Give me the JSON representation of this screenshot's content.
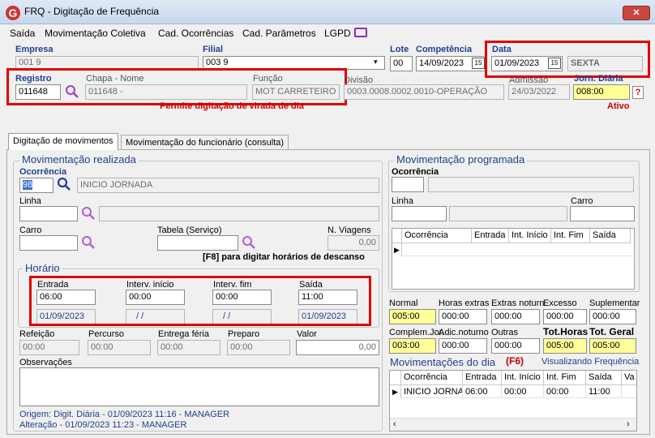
{
  "window": {
    "title": "FRQ - Digitação de Frequência",
    "close": "✕"
  },
  "menu": [
    "Saída",
    "Movimentação Coletiva",
    "Cad. Ocorrências",
    "Cad. Parâmetros",
    "LGPD"
  ],
  "header": {
    "empresa_label": "Empresa",
    "empresa_value": "001 9",
    "filial_label": "Filial",
    "filial_value": "003 9",
    "lote_label": "Lote",
    "lote_value": "00",
    "competencia_label": "Competência",
    "competencia_value": "14/09/2023",
    "data_label": "Data",
    "data_value": "01/09/2023",
    "dia_semana": "SEXTA",
    "registro_label": "Registro",
    "registro_value": "011648",
    "chapa_label": "Chapa  -  Nome",
    "chapa_value": "011648 -",
    "funcao_label": "Função",
    "funcao_value": "MOT CARRETEIRO",
    "divisao_label": "Divisão",
    "divisao_value": "0003.0008.0002.0010-OPERAÇÃO",
    "admissao_label": "Admissão",
    "admissao_value": "24/03/2022",
    "jornada_label": "Jorn. Diária",
    "jornada_value": "008:00",
    "help": "?",
    "aviso": "Permite digitação de virada de dia",
    "status": "Ativo",
    "cal_icon": "15"
  },
  "tabs": [
    "Digitação de movimentos",
    "Movimentação do funcionário (consulta)"
  ],
  "realizada": {
    "legend": "Movimentação realizada",
    "ocorrencia_label": "Ocorrência",
    "ocorrencia_code": "98",
    "ocorrencia_desc": "INICIO JORNADA",
    "linha_label": "Linha",
    "linha_value": "",
    "linha_desc": "",
    "carro_label": "Carro",
    "carro_value": "",
    "tabela_label": "Tabela (Serviço)",
    "tabela_value": "",
    "viagens_label": "N. Viagens",
    "viagens_value": "0,00",
    "hint": "[F8] para digitar horários de descanso"
  },
  "horario": {
    "legend": "Horário",
    "entrada_label": "Entrada",
    "entrada_value": "06:00",
    "entrada_data": "01/09/2023",
    "interv_ini_label": "Interv. início",
    "interv_ini_value": "00:00",
    "interv_ini_data": "/ /",
    "interv_fim_label": "Interv. fim",
    "interv_fim_value": "00:00",
    "interv_fim_data": "/ /",
    "saida_label": "Saída",
    "saida_value": "11:00",
    "saida_data": "01/09/2023"
  },
  "extras": {
    "refeicao_label": "Refeição",
    "refeicao_value": "00:00",
    "percurso_label": "Percurso",
    "percurso_value": "00:00",
    "entrega_label": "Entrega féria",
    "entrega_value": "00:00",
    "preparo_label": "Preparo",
    "preparo_value": "00:00",
    "valor_label": "Valor",
    "valor_value": "0,00",
    "obs_label": "Observações",
    "origem": "Origem: Digit. Diária - 01/09/2023 11:16 - MANAGER",
    "alteracao": "Alteração - 01/09/2023 11:23 - MANAGER"
  },
  "programada": {
    "legend": "Movimentação programada",
    "ocorrencia_label": "Ocorrência",
    "linha_label": "Linha",
    "carro_label": "Carro",
    "columns": [
      "Ocorrência",
      "Entrada",
      "Int. Início",
      "Int. Fim",
      "Saída"
    ]
  },
  "totais": {
    "normal_label": "Normal",
    "normal_value": "005:00",
    "horas_extras_label": "Horas extras",
    "horas_extras_value": "000:00",
    "extras_noturn_label": "Extras noturn.",
    "extras_noturn_value": "000:00",
    "excesso_label": "Excesso",
    "excesso_value": "000:00",
    "suplementar_label": "Suplementar",
    "suplementar_value": "000:00",
    "complem_label": "Complem.Jor.",
    "complem_value": "003:00",
    "adic_label": "Adic.noturno",
    "adic_value": "000:00",
    "outras_label": "Outras",
    "outras_value": "000:00",
    "tot_horas_label": "Tot.Horas",
    "tot_horas_value": "005:00",
    "tot_geral_label": "Tot. Geral",
    "tot_geral_value": "005:00"
  },
  "dia": {
    "title": "Movimentações do dia",
    "key": "(F6)",
    "visualizando": "Visualizando Frequência",
    "columns": [
      "Ocorrência",
      "Entrada",
      "Int. Início",
      "Int. Fim",
      "Saída",
      "Va"
    ],
    "rows": [
      [
        "INICIO JORNA",
        "06:00",
        "00:00",
        "00:00",
        "11:00",
        ""
      ]
    ]
  },
  "colors": {
    "highlight": "#e00000",
    "yellow": "#ffff99",
    "accent_blue": "#1f3f8f"
  }
}
